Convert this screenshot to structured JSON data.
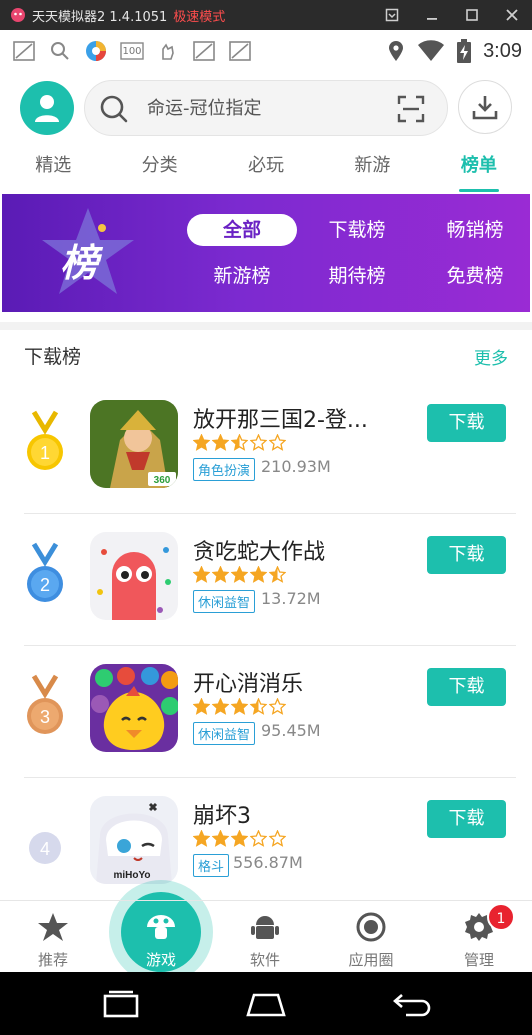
{
  "emulator": {
    "app_name": "天天模拟器2 1.4.1051",
    "mode": "极速模式",
    "controls": [
      "settings",
      "minimize",
      "maximize",
      "close"
    ]
  },
  "status_bar": {
    "time": "3:09",
    "notification_text": "100"
  },
  "search": {
    "placeholder": "命运-冠位指定"
  },
  "tabs": [
    "精选",
    "分类",
    "必玩",
    "新游",
    "榜单"
  ],
  "active_tab_index": 4,
  "banner": {
    "badge_text": "榜",
    "options": [
      "全部",
      "下载榜",
      "畅销榜",
      "新游榜",
      "期待榜",
      "免费榜"
    ],
    "active_option": "全部"
  },
  "section": {
    "title": "下载榜",
    "more": "更多"
  },
  "apps": [
    {
      "rank": "1",
      "name": "放开那三国2-登...",
      "rating": 2.5,
      "tag": "角色扮演",
      "size": "210.93M",
      "button": "下载",
      "icon_badge": "360"
    },
    {
      "rank": "2",
      "name": "贪吃蛇大作战",
      "rating": 4.5,
      "tag": "休闲益智",
      "size": "13.72M",
      "button": "下载"
    },
    {
      "rank": "3",
      "name": "开心消消乐",
      "rating": 3.5,
      "tag": "休闲益智",
      "size": "95.45M",
      "button": "下载"
    },
    {
      "rank": "4",
      "name": "崩坏3",
      "rating": 3,
      "tag": "格斗",
      "size": "556.87M",
      "button": "下载",
      "icon_badge": "miHoYo"
    }
  ],
  "bottom_nav": {
    "items": [
      "推荐",
      "游戏",
      "软件",
      "应用圈",
      "管理"
    ],
    "active_index": 1,
    "badge_count": "1"
  },
  "colors": {
    "accent": "#1dbfad",
    "banner_start": "#5a1bb5",
    "banner_end": "#9a2bd4",
    "tag_blue": "#2a9fd6",
    "star": "#f5a623",
    "badge_red": "#e8232f"
  }
}
